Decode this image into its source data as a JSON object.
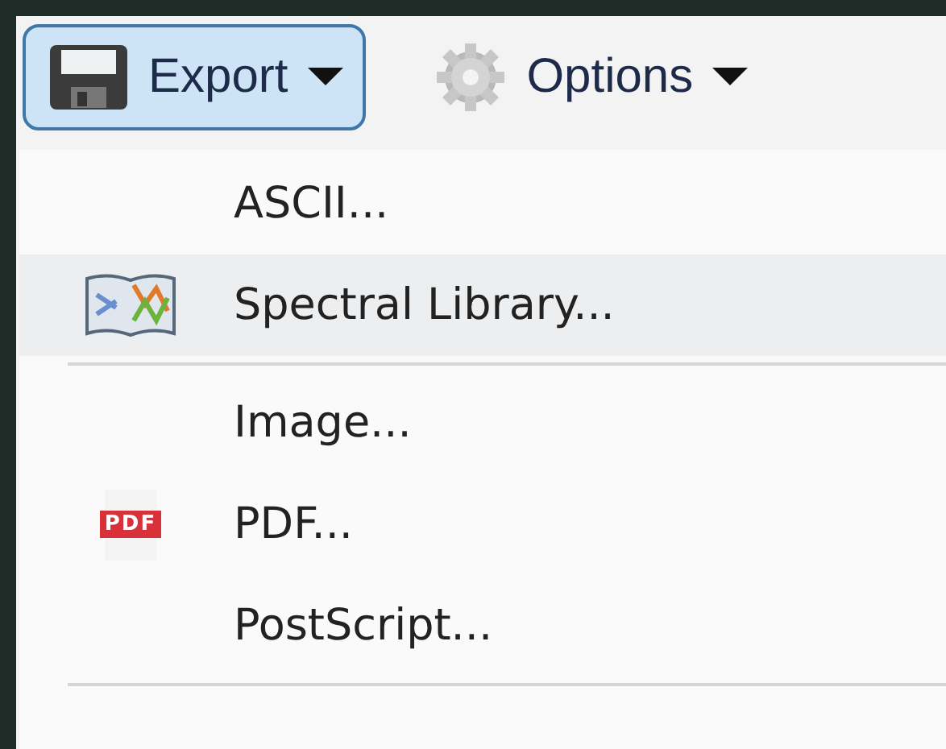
{
  "toolbar": [
    {
      "label": "Export",
      "kind": "save",
      "selected": true
    },
    {
      "label": "Options",
      "kind": "settings",
      "selected": false
    }
  ],
  "menu": {
    "items": [
      {
        "kind": "text",
        "label": "ASCII...",
        "selected": false
      },
      {
        "kind": "book",
        "label": "Spectral Library...",
        "selected": true
      },
      {
        "kind": "separator"
      },
      {
        "kind": "text",
        "label": "Image...",
        "selected": false
      },
      {
        "kind": "pdf",
        "label": "PDF...",
        "icon_text": "PDF",
        "selected": false
      },
      {
        "kind": "text",
        "label": "PostScript...",
        "selected": false
      },
      {
        "kind": "separator"
      }
    ]
  }
}
